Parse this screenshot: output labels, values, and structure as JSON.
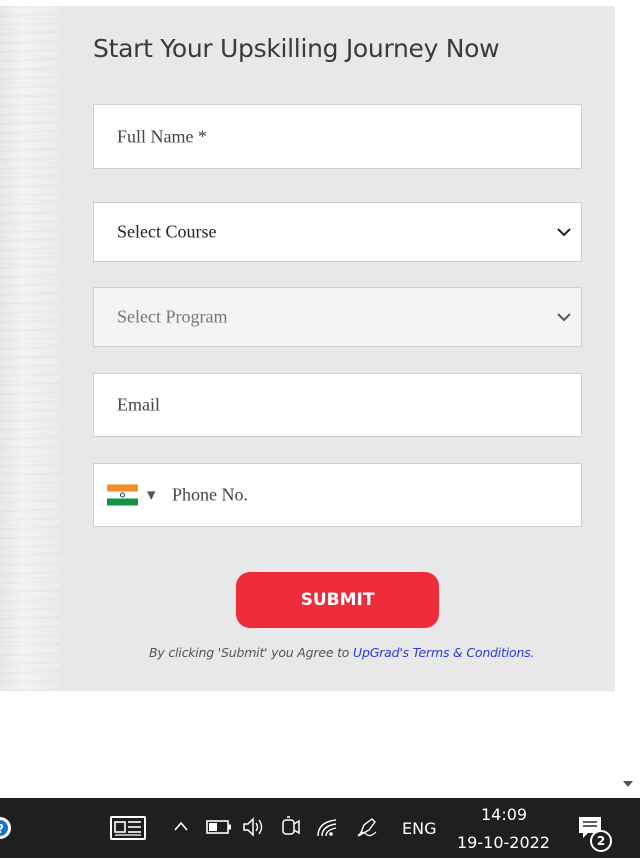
{
  "form": {
    "title": "Start Your Upskilling Journey Now",
    "full_name_placeholder": "Full Name *",
    "course_select": "Select Course",
    "program_select": "Select Program",
    "email_placeholder": "Email",
    "phone_placeholder": "Phone No.",
    "phone_country_icon": "india-flag-icon",
    "submit_label": "SUBMIT",
    "consent_prefix": "By clicking 'Submit' you Agree to ",
    "consent_link": "UpGrad's Terms & Conditions",
    "consent_suffix": ".",
    "accent_color": "#ee2c3c",
    "link_color": "#2a3bd6"
  },
  "taskbar": {
    "language": "ENG",
    "time": "14:09",
    "date": "19-10-2022",
    "notification_count": "2",
    "icons": [
      "edge-icon",
      "news-icon",
      "chevron-up-icon",
      "battery-icon",
      "volume-icon",
      "camera-icon",
      "wifi-icon",
      "pen-icon",
      "notifications-icon"
    ]
  }
}
